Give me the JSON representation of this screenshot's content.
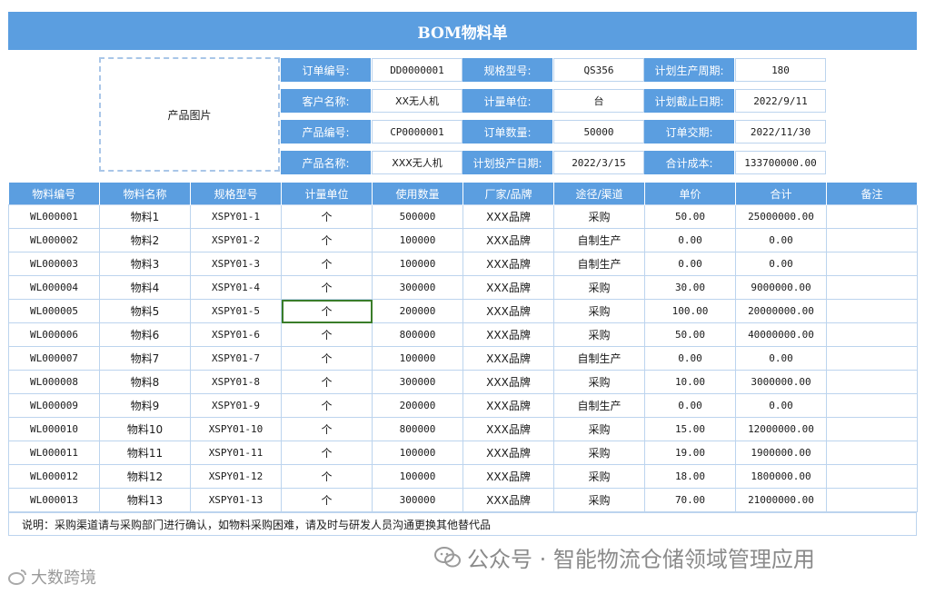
{
  "title": "BOM物料单",
  "photo_placeholder": "产品图片",
  "info": [
    [
      {
        "label": "订单编号:",
        "value": "DD0000001"
      },
      {
        "label": "规格型号:",
        "value": "QS356"
      },
      {
        "label": "计划生产周期:",
        "value": "180"
      }
    ],
    [
      {
        "label": "客户名称:",
        "value": "XX无人机"
      },
      {
        "label": "计量单位:",
        "value": "台"
      },
      {
        "label": "计划截止日期:",
        "value": "2022/9/11"
      }
    ],
    [
      {
        "label": "产品编号:",
        "value": "CP0000001"
      },
      {
        "label": "订单数量:",
        "value": "50000"
      },
      {
        "label": "订单交期:",
        "value": "2022/11/30"
      }
    ],
    [
      {
        "label": "产品名称:",
        "value": "XXX无人机"
      },
      {
        "label": "计划投产日期:",
        "value": "2022/3/15"
      },
      {
        "label": "合计成本:",
        "value": "133700000.00"
      }
    ]
  ],
  "table": {
    "headers": [
      "物料编号",
      "物料名称",
      "规格型号",
      "计量单位",
      "使用数量",
      "厂家/品牌",
      "途径/渠道",
      "单价",
      "合计",
      "备注"
    ],
    "rows": [
      [
        "WL000001",
        "物料1",
        "XSPY01-1",
        "个",
        "500000",
        "XXX品牌",
        "采购",
        "50.00",
        "25000000.00",
        ""
      ],
      [
        "WL000002",
        "物料2",
        "XSPY01-2",
        "个",
        "100000",
        "XXX品牌",
        "自制生产",
        "0.00",
        "0.00",
        ""
      ],
      [
        "WL000003",
        "物料3",
        "XSPY01-3",
        "个",
        "100000",
        "XXX品牌",
        "自制生产",
        "0.00",
        "0.00",
        ""
      ],
      [
        "WL000004",
        "物料4",
        "XSPY01-4",
        "个",
        "300000",
        "XXX品牌",
        "采购",
        "30.00",
        "9000000.00",
        ""
      ],
      [
        "WL000005",
        "物料5",
        "XSPY01-5",
        "个",
        "200000",
        "XXX品牌",
        "采购",
        "100.00",
        "20000000.00",
        ""
      ],
      [
        "WL000006",
        "物料6",
        "XSPY01-6",
        "个",
        "800000",
        "XXX品牌",
        "采购",
        "50.00",
        "40000000.00",
        ""
      ],
      [
        "WL000007",
        "物料7",
        "XSPY01-7",
        "个",
        "100000",
        "XXX品牌",
        "自制生产",
        "0.00",
        "0.00",
        ""
      ],
      [
        "WL000008",
        "物料8",
        "XSPY01-8",
        "个",
        "300000",
        "XXX品牌",
        "采购",
        "10.00",
        "3000000.00",
        ""
      ],
      [
        "WL000009",
        "物料9",
        "XSPY01-9",
        "个",
        "200000",
        "XXX品牌",
        "自制生产",
        "0.00",
        "0.00",
        ""
      ],
      [
        "WL000010",
        "物料10",
        "XSPY01-10",
        "个",
        "800000",
        "XXX品牌",
        "采购",
        "15.00",
        "12000000.00",
        ""
      ],
      [
        "WL000011",
        "物料11",
        "XSPY01-11",
        "个",
        "100000",
        "XXX品牌",
        "采购",
        "19.00",
        "1900000.00",
        ""
      ],
      [
        "WL000012",
        "物料12",
        "XSPY01-12",
        "个",
        "100000",
        "XXX品牌",
        "采购",
        "18.00",
        "1800000.00",
        ""
      ],
      [
        "WL000013",
        "物料13",
        "XSPY01-13",
        "个",
        "300000",
        "XXX品牌",
        "采购",
        "70.00",
        "21000000.00",
        ""
      ]
    ]
  },
  "note": "说明：采购渠道请与采购部门进行确认，如物料采购困难，请及时与研发人员沟通更换其他替代品",
  "watermark_main": "公众号 · 智能物流仓储领域管理应用",
  "watermark_corner": "大数跨境",
  "icons": {
    "wechat": "wechat-icon",
    "corner": "weibo-like-icon"
  },
  "colors": {
    "header": "#5b9ee0",
    "border": "#bcd4ee",
    "selection": "#3a7d2a"
  }
}
